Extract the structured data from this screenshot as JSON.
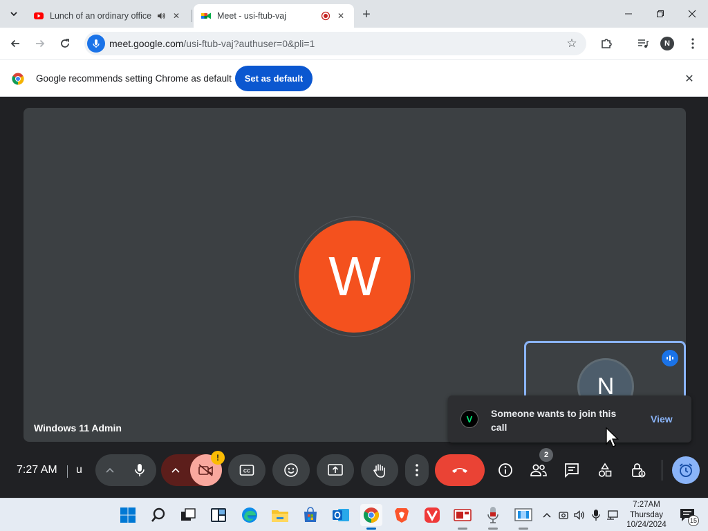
{
  "tabs": [
    {
      "title": "Lunch of an ordinary office",
      "favicon": "youtube-icon",
      "indicator": "speaker-icon",
      "active": false
    },
    {
      "title": "Meet - usi-ftub-vaj",
      "favicon": "google-meet-icon",
      "indicator": "recording-icon",
      "active": true
    }
  ],
  "toolbar": {
    "url_host": "meet.google.com",
    "url_path": "/usi-ftub-vaj?authuser=0&pli=1",
    "profile_initial": "N"
  },
  "infobar": {
    "message": "Google recommends setting Chrome as default",
    "button_label": "Set as default"
  },
  "meet": {
    "main_participant_initial": "W",
    "main_participant_name": "Windows 11 Admin",
    "self_initial": "N",
    "toast_text": "Someone wants to join this call",
    "toast_icon_letter": "V",
    "toast_action": "View",
    "time": "7:27 AM",
    "meeting_code": "u",
    "people_count": "2",
    "warning_mark": "!"
  },
  "taskbar": {
    "time": "7:27AM",
    "day": "Thursday",
    "date": "10/24/2024",
    "notification_count": "15"
  },
  "colors": {
    "meet_background": "#202124",
    "tile": "#3c4043",
    "avatar_w": "#f4511e",
    "end_call": "#ea4335",
    "accent_blue": "#8ab4f8",
    "chrome_button": "#0b57d0"
  }
}
